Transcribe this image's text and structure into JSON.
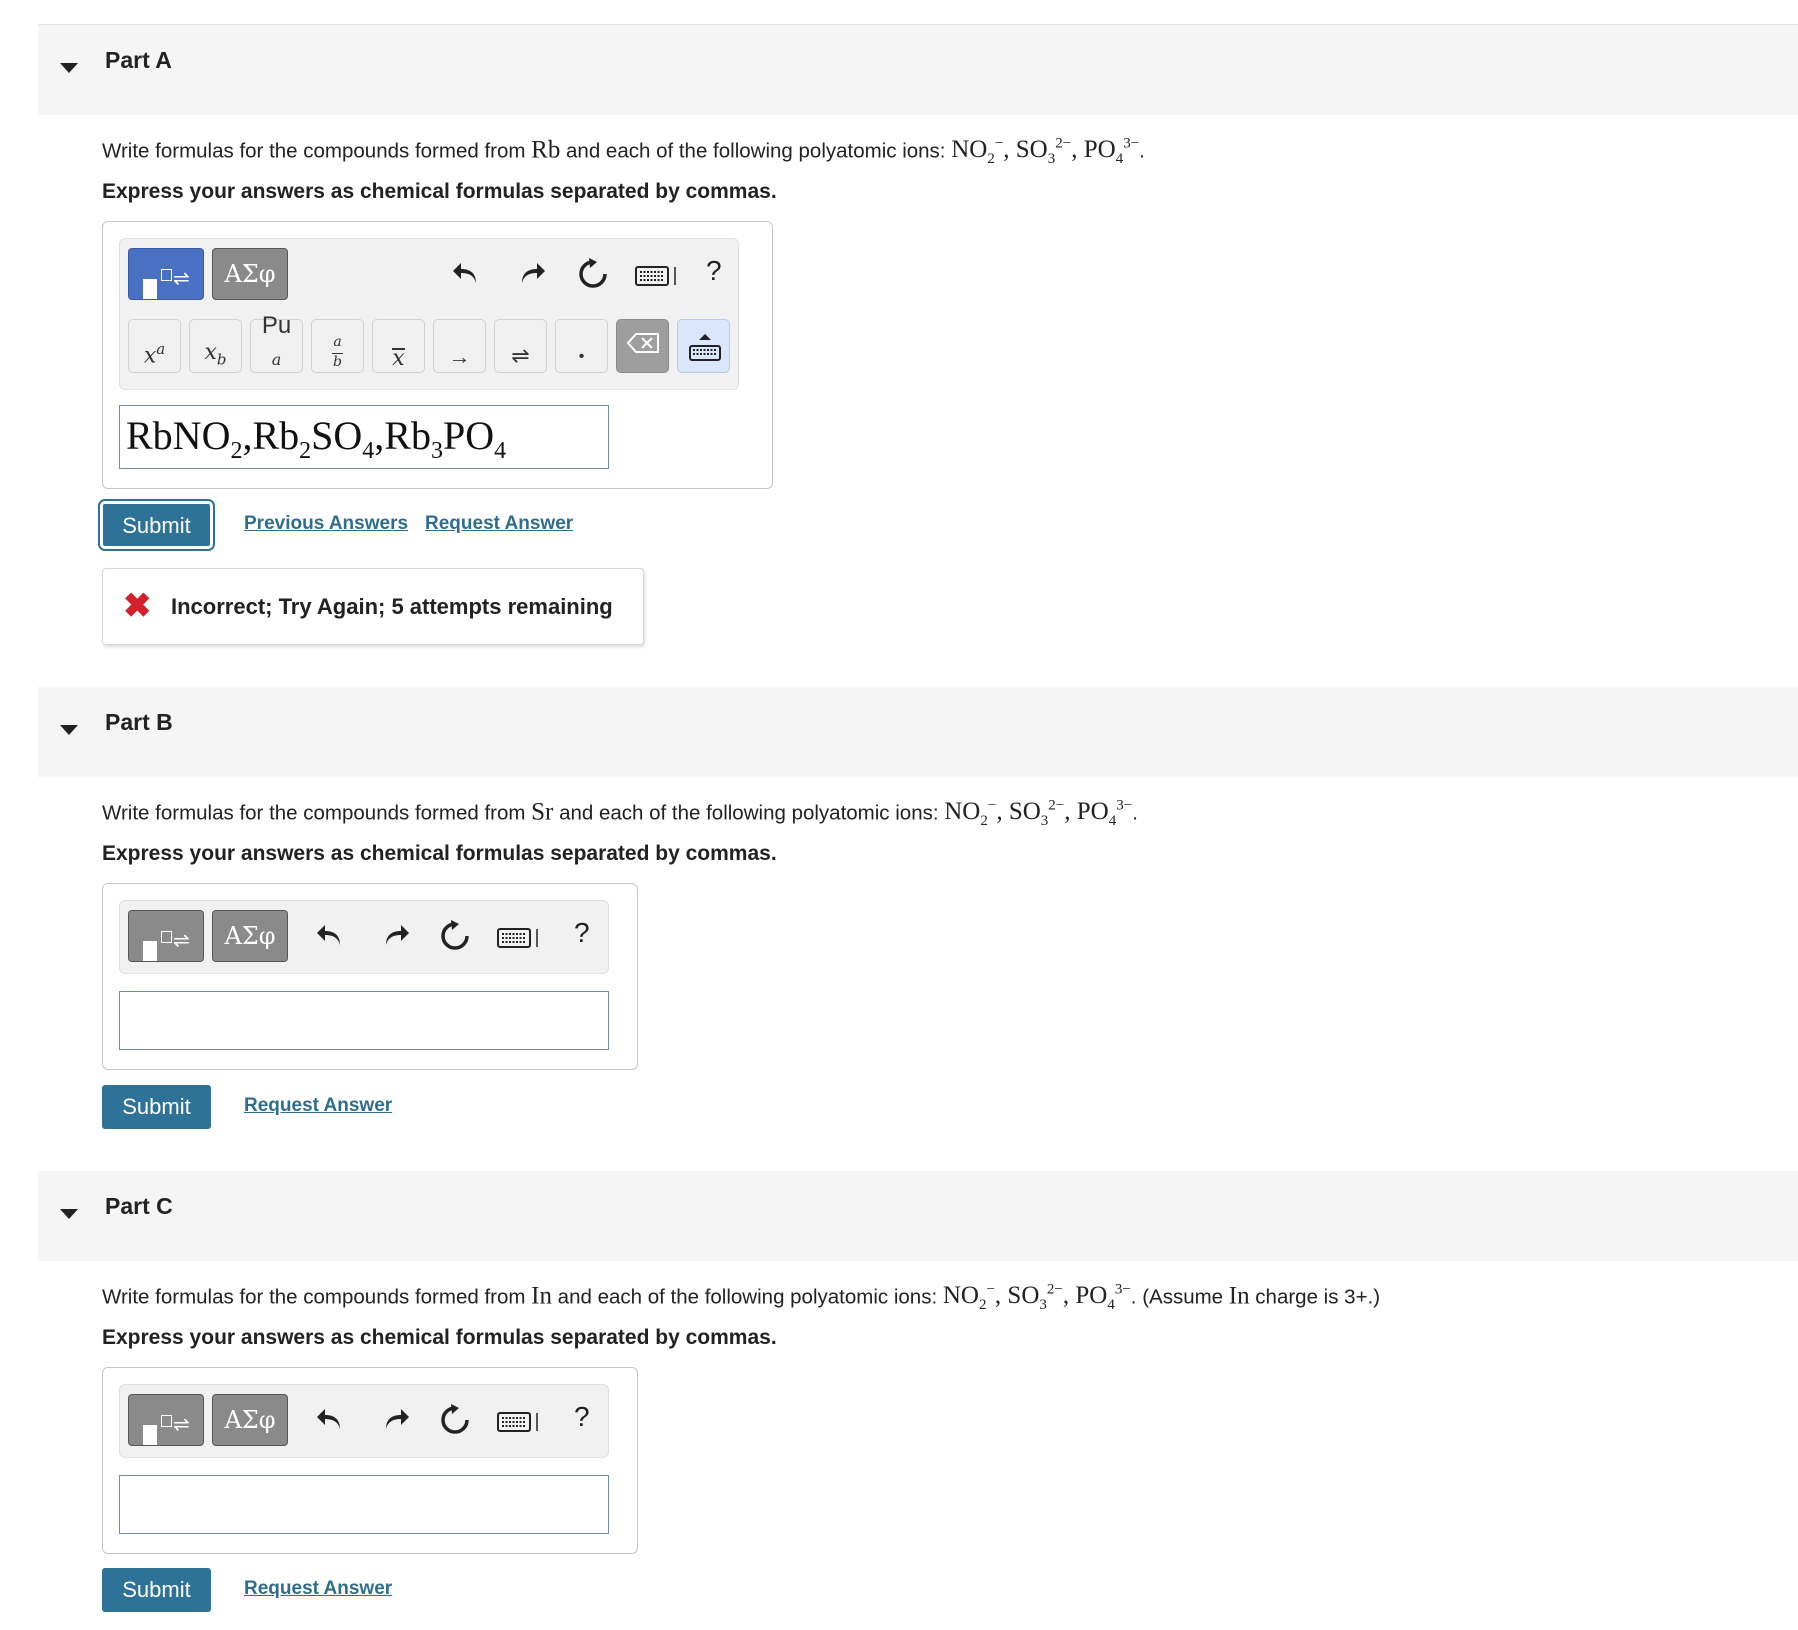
{
  "parts": [
    {
      "title": "Part A",
      "question_prefix": "Write formulas for the compounds formed from ",
      "element": "Rb",
      "question_mid": " and each of the following polyatomic ions: ",
      "question_suffix": ".",
      "instruction": "Express your answers as chemical formulas separated by commas.",
      "submit_label": "Submit",
      "previous_answers_label": "Previous Answers",
      "request_answer_label": "Request Answer",
      "feedback": "Incorrect; Try Again; 5 attempts remaining"
    },
    {
      "title": "Part B",
      "question_prefix": "Write formulas for the compounds formed from ",
      "element": "Sr",
      "question_mid": " and each of the following polyatomic ions: ",
      "question_suffix": ".",
      "instruction": "Express your answers as chemical formulas separated by commas.",
      "submit_label": "Submit",
      "request_answer_label": "Request Answer"
    },
    {
      "title": "Part C",
      "question_prefix": "Write formulas for the compounds formed from ",
      "element": "In",
      "question_mid": " and each of the following polyatomic ions: ",
      "question_suffix": ". (Assume ",
      "element_again": "In",
      "question_tail": " charge is 3+.)",
      "instruction": "Express your answers as chemical formulas separated by commas.",
      "submit_label": "Submit",
      "request_answer_label": "Request Answer"
    }
  ],
  "ions": {
    "no2": "NO",
    "no2_sub": "2",
    "no2_sup": "−",
    "so3": "SO",
    "so3_sub": "3",
    "so3_sup": "2−",
    "po4": "PO",
    "po4_sub": "4",
    "po4_sup": "3−",
    "sep": ", "
  },
  "part_a_answer": {
    "t1": "RbNO",
    "s1": "2",
    "t2": ",Rb",
    "s2": "2",
    "t3": "SO",
    "s3": "4",
    "t4": ",Rb",
    "s4": "3",
    "t5": "PO",
    "s5": "4"
  },
  "toolbar": {
    "greek_label": "ΑΣφ",
    "help_label": "?"
  },
  "keys": {
    "superscript": "x",
    "superscript_sup": "a",
    "subscript": "x",
    "subscript_sub": "b",
    "pu": "Pu",
    "pu_sub": "a",
    "frac_num": "a",
    "frac_den": "b",
    "xbar": "x",
    "arrow": "→",
    "equilibrium": "⇌",
    "dot": "•"
  },
  "colors": {
    "submit_bg": "#2f7297",
    "link": "#2f6d8f",
    "active_template": "#4a70c4",
    "error_x": "#d0212d"
  }
}
